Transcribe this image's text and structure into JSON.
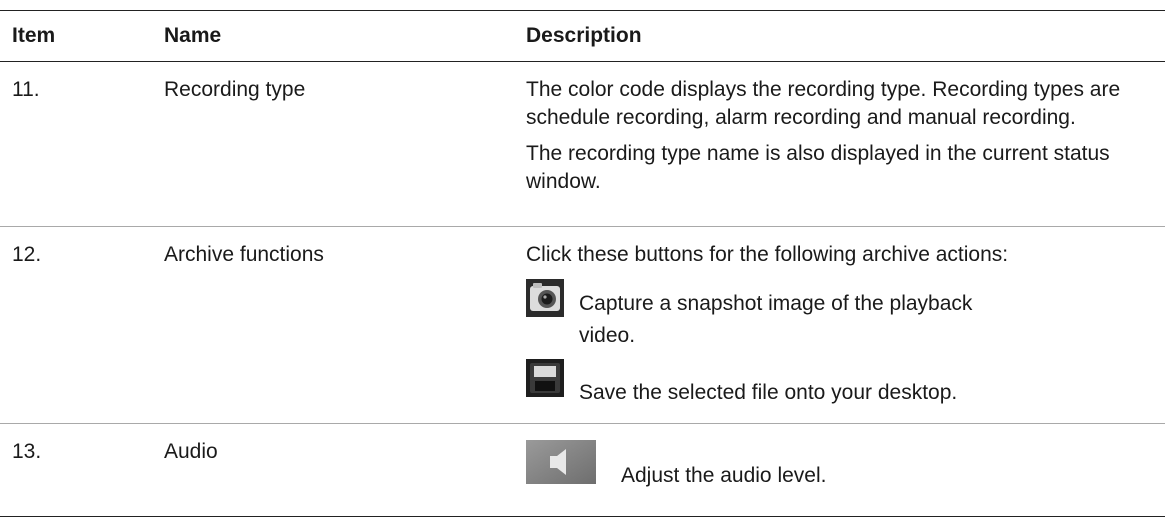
{
  "header": {
    "item": "Item",
    "name": "Name",
    "description": "Description"
  },
  "rows": [
    {
      "item": "11.",
      "name": "Recording type",
      "paragraphs": [
        "The color code displays the recording type. Recording types are schedule recording, alarm recording and manual recording.",
        "The recording type name is also displayed in the current status window."
      ]
    },
    {
      "item": "12.",
      "name": "Archive functions",
      "intro": "Click these buttons for the following archive actions:",
      "actions": [
        {
          "icon": "camera-snapshot-icon",
          "text_line1": "Capture a snapshot image of the playback",
          "text_line2": "video."
        },
        {
          "icon": "save-disk-icon",
          "text": "Save the selected file onto your desktop."
        }
      ]
    },
    {
      "item": "13.",
      "name": "Audio",
      "actions": [
        {
          "icon": "speaker-icon",
          "text": "Adjust the audio level."
        }
      ]
    }
  ]
}
